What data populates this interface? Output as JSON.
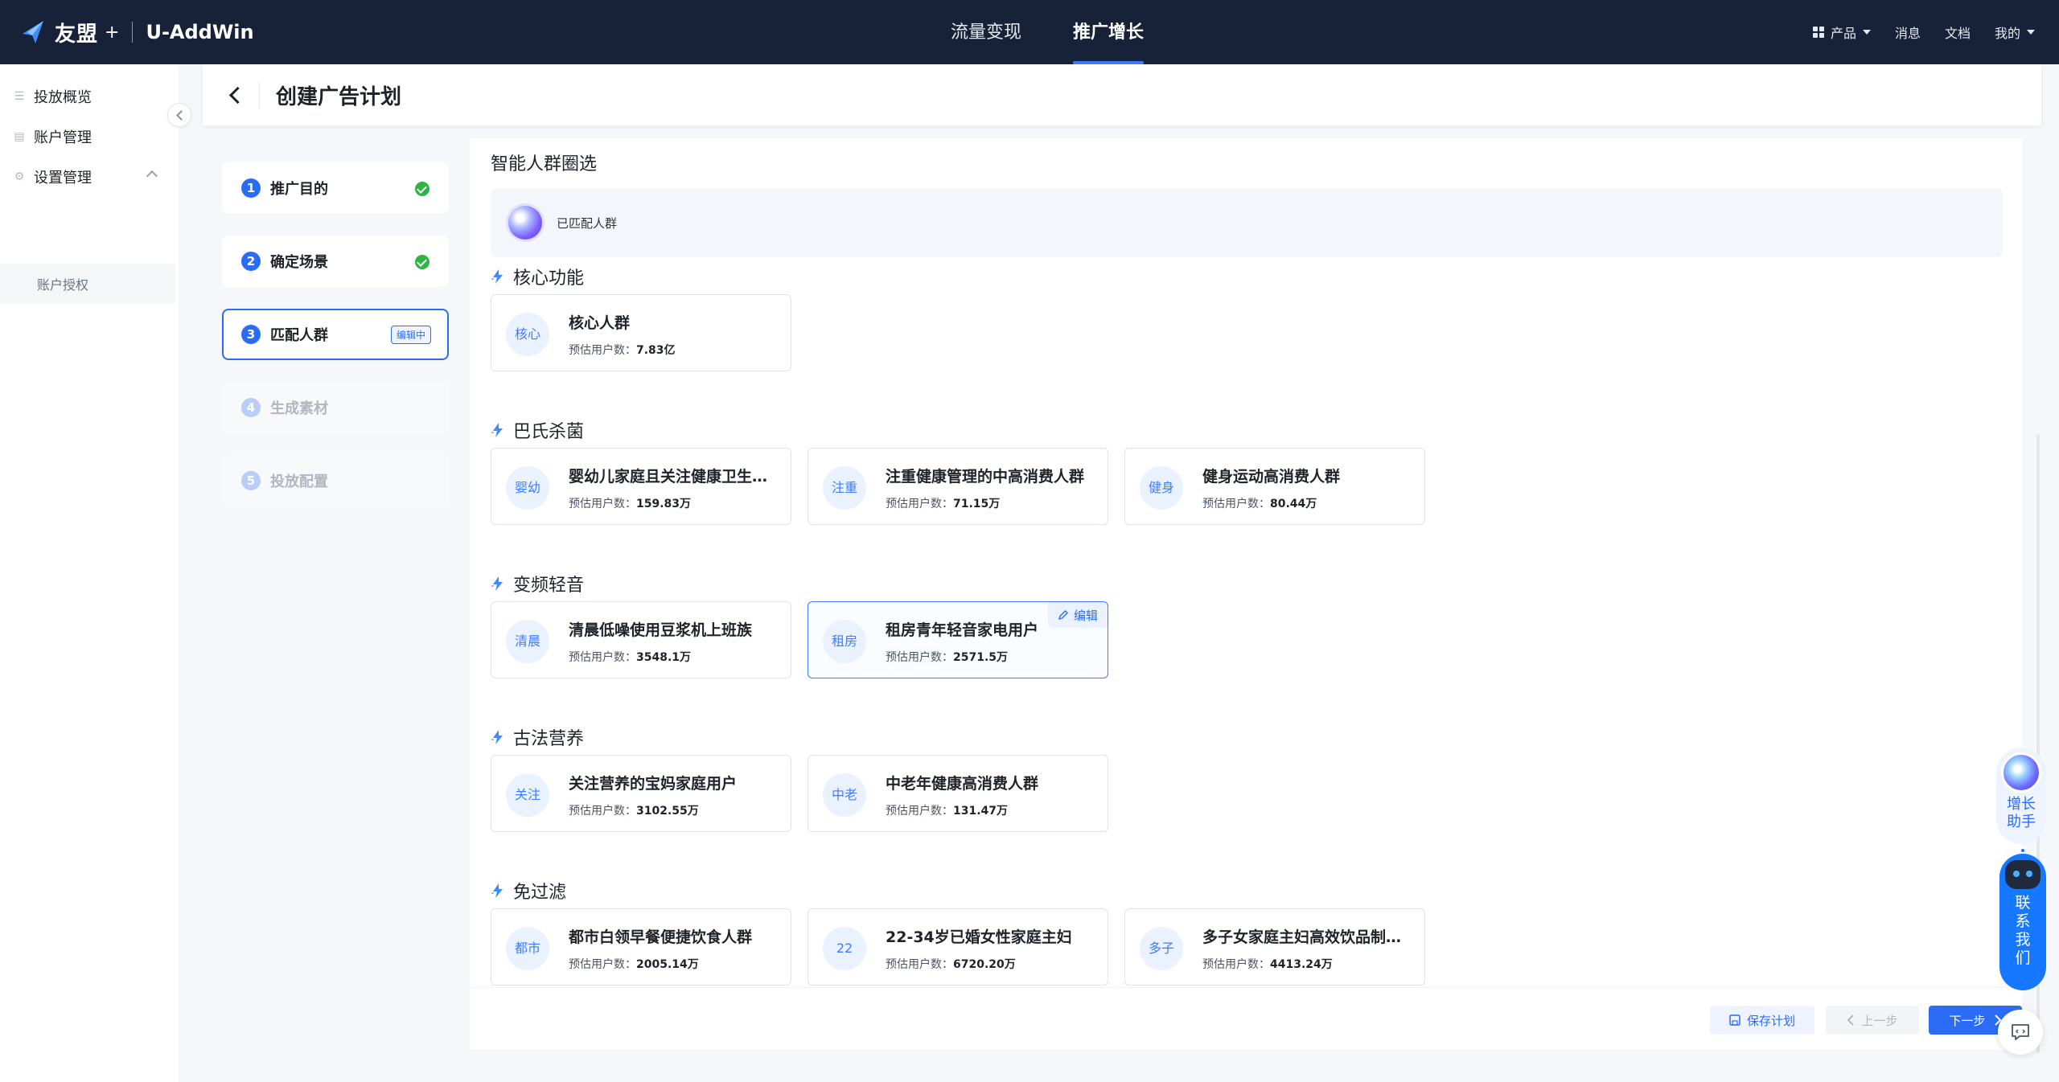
{
  "topbar": {
    "brand": "友盟",
    "brand_plus": "+",
    "product": "U-AddWin",
    "tabs": [
      {
        "label": "流量变现",
        "active": false
      },
      {
        "label": "推广增长",
        "active": true
      }
    ],
    "right": {
      "products": "产品",
      "messages": "消息",
      "docs": "文档",
      "mine": "我的"
    }
  },
  "sidebar": {
    "items": [
      {
        "label": "投放概览",
        "icon": "list-icon"
      },
      {
        "label": "账户管理",
        "icon": "account-icon"
      },
      {
        "label": "设置管理",
        "icon": "settings-icon"
      }
    ],
    "sub_item": "账户授权"
  },
  "header": {
    "title": "创建广告计划"
  },
  "steps": [
    {
      "num": "1",
      "label": "推广目的",
      "state": "done"
    },
    {
      "num": "2",
      "label": "确定场景",
      "state": "done"
    },
    {
      "num": "3",
      "label": "匹配人群",
      "state": "active",
      "badge": "编辑中"
    },
    {
      "num": "4",
      "label": "生成素材",
      "state": "todo"
    },
    {
      "num": "5",
      "label": "投放配置",
      "state": "todo"
    }
  ],
  "main": {
    "title": "智能人群圈选",
    "matched_label": "已匹配人群",
    "est_prefix": "预估用户数：",
    "edit_label": "编辑",
    "sections": [
      {
        "title": "核心功能",
        "cards": [
          {
            "avatar": "核心",
            "name": "核心人群",
            "count": "7.83亿"
          }
        ]
      },
      {
        "title": "巴氏杀菌",
        "cards": [
          {
            "avatar": "婴幼",
            "name": "婴幼儿家庭且关注健康卫生人群",
            "count": "159.83万"
          },
          {
            "avatar": "注重",
            "name": "注重健康管理的中高消费人群",
            "count": "71.15万"
          },
          {
            "avatar": "健身",
            "name": "健身运动高消费人群",
            "count": "80.44万"
          }
        ]
      },
      {
        "title": "变频轻音",
        "cards": [
          {
            "avatar": "清晨",
            "name": "清晨低噪使用豆浆机上班族",
            "count": "3548.1万"
          },
          {
            "avatar": "租房",
            "name": "租房青年轻音家电用户",
            "count": "2571.5万",
            "active": true
          }
        ]
      },
      {
        "title": "古法营养",
        "cards": [
          {
            "avatar": "关注",
            "name": "关注营养的宝妈家庭用户",
            "count": "3102.55万"
          },
          {
            "avatar": "中老",
            "name": "中老年健康高消费人群",
            "count": "131.47万"
          }
        ]
      },
      {
        "title": "免过滤",
        "cards": [
          {
            "avatar": "都市",
            "name": "都市白领早餐便捷饮食人群",
            "count": "2005.14万"
          },
          {
            "avatar": "22",
            "name": "22-34岁已婚女性家庭主妇",
            "count": "6720.20万"
          },
          {
            "avatar": "多子",
            "name": "多子女家庭主妇高效饮品制作需求人群",
            "count": "4413.24万"
          }
        ]
      }
    ]
  },
  "footer": {
    "save": "保存计划",
    "prev": "上一步",
    "next": "下一步"
  },
  "widgets": {
    "assistant": "增长助手",
    "contact": "联系我们"
  },
  "colors": {
    "primary": "#2b6cf6",
    "topbar": "#172239",
    "done": "#2fb344"
  }
}
